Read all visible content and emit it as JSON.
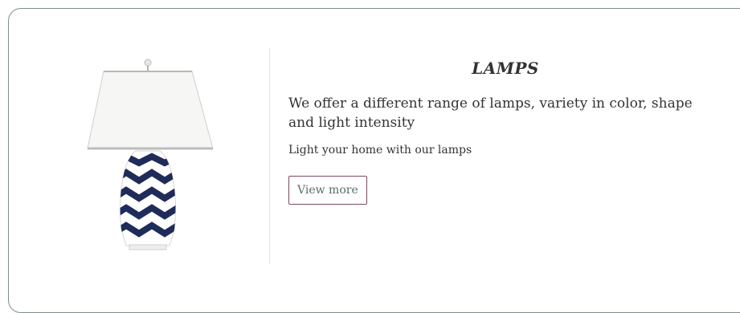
{
  "card": {
    "image_alt": "Blue and white chevron table lamp",
    "title": "LAMPS",
    "description": "We offer a different range of lamps, variety in color, shape and light intensity",
    "tagline": "Light your home with our lamps",
    "button_label": "View more"
  },
  "colors": {
    "lamp_shade": "#f6f6f4",
    "lamp_trim": "#c9c9c9",
    "lamp_pattern": "#1f2c5a",
    "card_border": "#7f8f88",
    "button_border": "#7d4b5b",
    "button_text": "#5b6e64"
  }
}
